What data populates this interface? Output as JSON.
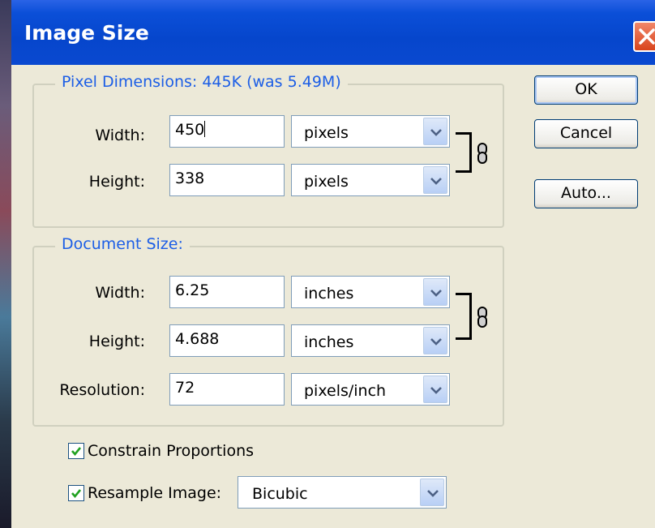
{
  "window": {
    "title": "Image Size"
  },
  "pixel_dimensions": {
    "legend": "Pixel Dimensions:  445K (was 5.49M)",
    "width": {
      "label": "Width:",
      "value": "450",
      "unit": "pixels"
    },
    "height": {
      "label": "Height:",
      "value": "338",
      "unit": "pixels"
    }
  },
  "document_size": {
    "legend": "Document Size:",
    "width": {
      "label": "Width:",
      "value": "6.25",
      "unit": "inches"
    },
    "height": {
      "label": "Height:",
      "value": "4.688",
      "unit": "inches"
    },
    "resolution": {
      "label": "Resolution:",
      "value": "72",
      "unit": "pixels/inch"
    }
  },
  "buttons": {
    "ok": "OK",
    "cancel": "Cancel",
    "auto": "Auto..."
  },
  "options": {
    "constrain": {
      "label": "Constrain Proportions",
      "checked": true
    },
    "resample": {
      "label": "Resample Image:",
      "checked": true,
      "method": "Bicubic"
    }
  },
  "colors": {
    "titlebar": "#0646cc",
    "legend_text": "#1c5ee6",
    "background": "#ece9d8"
  },
  "icons": {
    "close": "close-icon",
    "link": "chain-link-icon",
    "dropdown": "chevron-down-icon",
    "check": "checkmark-icon"
  }
}
